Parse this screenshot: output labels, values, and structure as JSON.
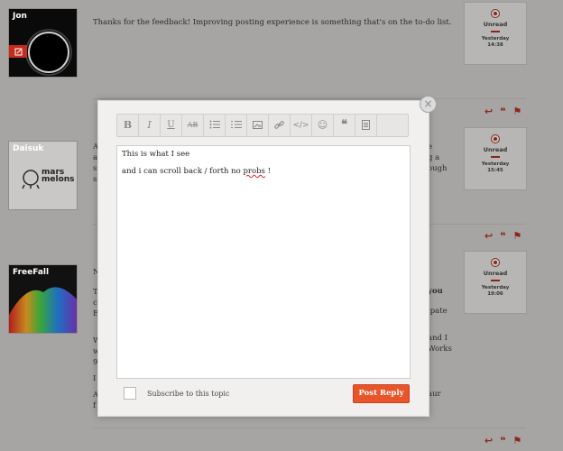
{
  "posts": [
    {
      "username": "Jon",
      "text": "Thanks for the feedback! Improving posting experience is something that's on the to-do list.",
      "status": "Unread",
      "date": "Yesterday",
      "time": "14:38"
    },
    {
      "username": "Daisuk",
      "logo_text_1": "mars",
      "logo_text_2": "melons",
      "status": "Unread",
      "date": "Yesterday",
      "time": "15:45"
    },
    {
      "username": "FreeFall",
      "status": "Unread",
      "date": "Yesterday",
      "time": "19:06"
    }
  ],
  "background_fragments": {
    "p2_left": [
      "A",
      "a",
      "s",
      "s"
    ],
    "p2_right": [
      "e",
      "g a",
      "ough",
      ""
    ],
    "p3_left": [
      "N",
      "",
      "T",
      "c",
      "E",
      "",
      "W",
      "w",
      "9",
      "",
      "I",
      "",
      "A",
      "f"
    ],
    "p3_right": [
      "you",
      "ipate",
      "",
      "and I",
      "Works",
      "",
      "aur",
      ""
    ]
  },
  "modal": {
    "editor_lines": [
      "This is what I see",
      "and i can scroll back / forth no probs !"
    ],
    "subscribe_label": "Subscribe to this topic",
    "post_reply_label": "Post Reply",
    "close_glyph": "×"
  },
  "toolbar": {
    "bold": "B",
    "italic": "I",
    "underline": "U",
    "strike": "AB"
  },
  "colors": {
    "accent": "#e8552a",
    "brand_red": "#8e2418",
    "overlay_bg": "#a6a5a4"
  }
}
